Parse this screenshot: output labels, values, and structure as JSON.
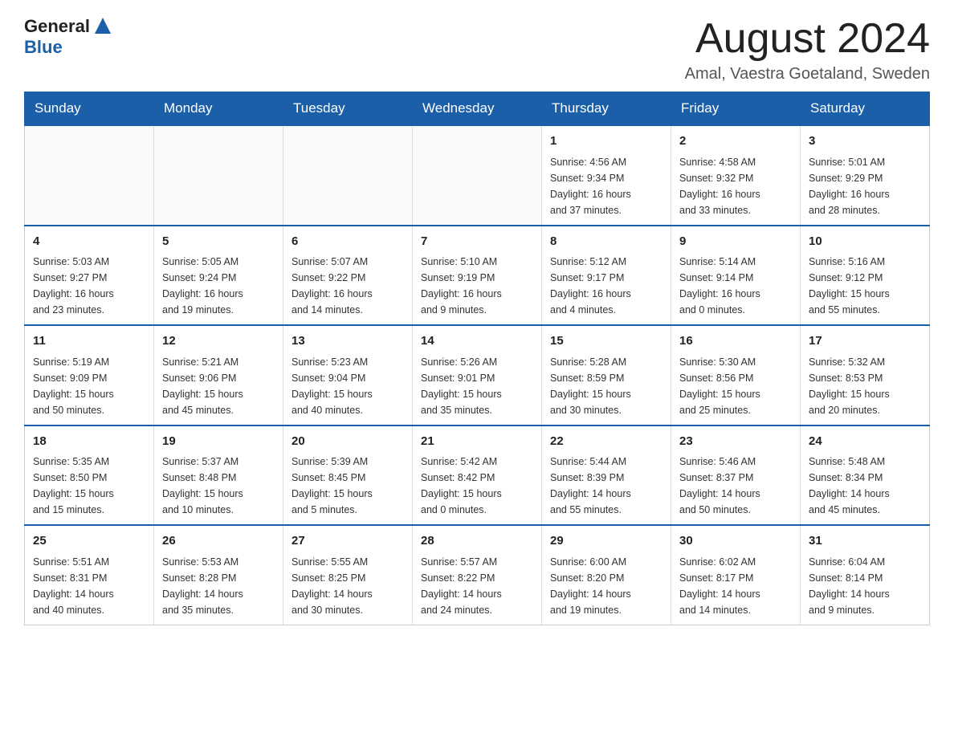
{
  "header": {
    "logo_general": "General",
    "logo_blue": "Blue",
    "month": "August 2024",
    "location": "Amal, Vaestra Goetaland, Sweden"
  },
  "weekdays": [
    "Sunday",
    "Monday",
    "Tuesday",
    "Wednesday",
    "Thursday",
    "Friday",
    "Saturday"
  ],
  "weeks": [
    [
      {
        "day": "",
        "info": ""
      },
      {
        "day": "",
        "info": ""
      },
      {
        "day": "",
        "info": ""
      },
      {
        "day": "",
        "info": ""
      },
      {
        "day": "1",
        "info": "Sunrise: 4:56 AM\nSunset: 9:34 PM\nDaylight: 16 hours\nand 37 minutes."
      },
      {
        "day": "2",
        "info": "Sunrise: 4:58 AM\nSunset: 9:32 PM\nDaylight: 16 hours\nand 33 minutes."
      },
      {
        "day": "3",
        "info": "Sunrise: 5:01 AM\nSunset: 9:29 PM\nDaylight: 16 hours\nand 28 minutes."
      }
    ],
    [
      {
        "day": "4",
        "info": "Sunrise: 5:03 AM\nSunset: 9:27 PM\nDaylight: 16 hours\nand 23 minutes."
      },
      {
        "day": "5",
        "info": "Sunrise: 5:05 AM\nSunset: 9:24 PM\nDaylight: 16 hours\nand 19 minutes."
      },
      {
        "day": "6",
        "info": "Sunrise: 5:07 AM\nSunset: 9:22 PM\nDaylight: 16 hours\nand 14 minutes."
      },
      {
        "day": "7",
        "info": "Sunrise: 5:10 AM\nSunset: 9:19 PM\nDaylight: 16 hours\nand 9 minutes."
      },
      {
        "day": "8",
        "info": "Sunrise: 5:12 AM\nSunset: 9:17 PM\nDaylight: 16 hours\nand 4 minutes."
      },
      {
        "day": "9",
        "info": "Sunrise: 5:14 AM\nSunset: 9:14 PM\nDaylight: 16 hours\nand 0 minutes."
      },
      {
        "day": "10",
        "info": "Sunrise: 5:16 AM\nSunset: 9:12 PM\nDaylight: 15 hours\nand 55 minutes."
      }
    ],
    [
      {
        "day": "11",
        "info": "Sunrise: 5:19 AM\nSunset: 9:09 PM\nDaylight: 15 hours\nand 50 minutes."
      },
      {
        "day": "12",
        "info": "Sunrise: 5:21 AM\nSunset: 9:06 PM\nDaylight: 15 hours\nand 45 minutes."
      },
      {
        "day": "13",
        "info": "Sunrise: 5:23 AM\nSunset: 9:04 PM\nDaylight: 15 hours\nand 40 minutes."
      },
      {
        "day": "14",
        "info": "Sunrise: 5:26 AM\nSunset: 9:01 PM\nDaylight: 15 hours\nand 35 minutes."
      },
      {
        "day": "15",
        "info": "Sunrise: 5:28 AM\nSunset: 8:59 PM\nDaylight: 15 hours\nand 30 minutes."
      },
      {
        "day": "16",
        "info": "Sunrise: 5:30 AM\nSunset: 8:56 PM\nDaylight: 15 hours\nand 25 minutes."
      },
      {
        "day": "17",
        "info": "Sunrise: 5:32 AM\nSunset: 8:53 PM\nDaylight: 15 hours\nand 20 minutes."
      }
    ],
    [
      {
        "day": "18",
        "info": "Sunrise: 5:35 AM\nSunset: 8:50 PM\nDaylight: 15 hours\nand 15 minutes."
      },
      {
        "day": "19",
        "info": "Sunrise: 5:37 AM\nSunset: 8:48 PM\nDaylight: 15 hours\nand 10 minutes."
      },
      {
        "day": "20",
        "info": "Sunrise: 5:39 AM\nSunset: 8:45 PM\nDaylight: 15 hours\nand 5 minutes."
      },
      {
        "day": "21",
        "info": "Sunrise: 5:42 AM\nSunset: 8:42 PM\nDaylight: 15 hours\nand 0 minutes."
      },
      {
        "day": "22",
        "info": "Sunrise: 5:44 AM\nSunset: 8:39 PM\nDaylight: 14 hours\nand 55 minutes."
      },
      {
        "day": "23",
        "info": "Sunrise: 5:46 AM\nSunset: 8:37 PM\nDaylight: 14 hours\nand 50 minutes."
      },
      {
        "day": "24",
        "info": "Sunrise: 5:48 AM\nSunset: 8:34 PM\nDaylight: 14 hours\nand 45 minutes."
      }
    ],
    [
      {
        "day": "25",
        "info": "Sunrise: 5:51 AM\nSunset: 8:31 PM\nDaylight: 14 hours\nand 40 minutes."
      },
      {
        "day": "26",
        "info": "Sunrise: 5:53 AM\nSunset: 8:28 PM\nDaylight: 14 hours\nand 35 minutes."
      },
      {
        "day": "27",
        "info": "Sunrise: 5:55 AM\nSunset: 8:25 PM\nDaylight: 14 hours\nand 30 minutes."
      },
      {
        "day": "28",
        "info": "Sunrise: 5:57 AM\nSunset: 8:22 PM\nDaylight: 14 hours\nand 24 minutes."
      },
      {
        "day": "29",
        "info": "Sunrise: 6:00 AM\nSunset: 8:20 PM\nDaylight: 14 hours\nand 19 minutes."
      },
      {
        "day": "30",
        "info": "Sunrise: 6:02 AM\nSunset: 8:17 PM\nDaylight: 14 hours\nand 14 minutes."
      },
      {
        "day": "31",
        "info": "Sunrise: 6:04 AM\nSunset: 8:14 PM\nDaylight: 14 hours\nand 9 minutes."
      }
    ]
  ]
}
